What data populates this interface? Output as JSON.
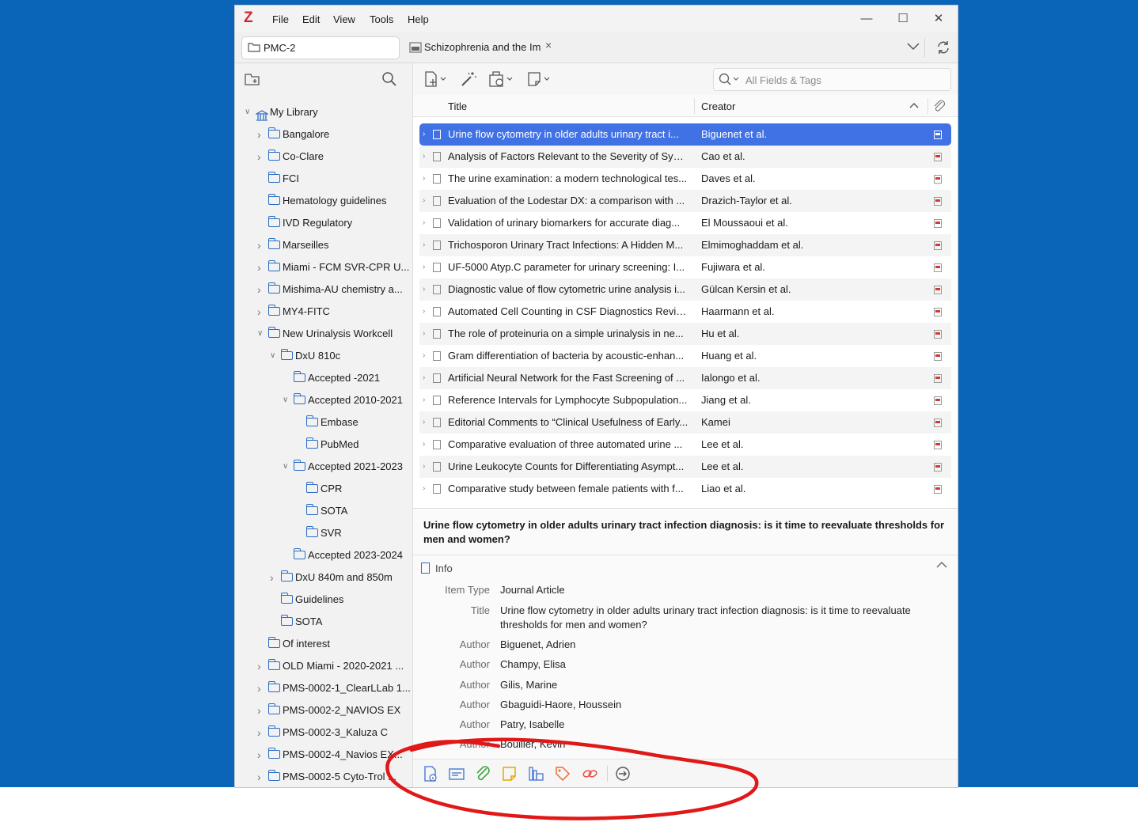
{
  "menubar": {
    "logo": "Z",
    "items": [
      "File",
      "Edit",
      "View",
      "Tools",
      "Help"
    ],
    "minimize_icon": "minimize-icon",
    "maximize_icon": "maximize-icon",
    "close_icon": "close-icon"
  },
  "tabs": {
    "library_tab": "PMC-2",
    "doc_tab": "Schizophrenia and the Im",
    "doc_tab_close": "×"
  },
  "search": {
    "placeholder": "All Fields & Tags"
  },
  "columns": {
    "title": "Title",
    "creator": "Creator",
    "sort_glyph": "^"
  },
  "tree": [
    {
      "label": "My Library",
      "level": 0,
      "twisty": "open",
      "icon": "library"
    },
    {
      "label": "Bangalore",
      "level": 1,
      "twisty": "closed"
    },
    {
      "label": "Co-Clare",
      "level": 1,
      "twisty": "closed"
    },
    {
      "label": "FCI",
      "level": 1,
      "twisty": "none"
    },
    {
      "label": "Hematology guidelines",
      "level": 1,
      "twisty": "none"
    },
    {
      "label": "IVD Regulatory",
      "level": 1,
      "twisty": "none"
    },
    {
      "label": "Marseilles",
      "level": 1,
      "twisty": "closed"
    },
    {
      "label": "Miami - FCM SVR-CPR U...",
      "level": 1,
      "twisty": "closed"
    },
    {
      "label": "Mishima-AU chemistry a...",
      "level": 1,
      "twisty": "closed"
    },
    {
      "label": "MY4-FITC",
      "level": 1,
      "twisty": "closed"
    },
    {
      "label": "New Urinalysis Workcell",
      "level": 1,
      "twisty": "open"
    },
    {
      "label": "DxU 810c",
      "level": 2,
      "twisty": "open"
    },
    {
      "label": "Accepted -2021",
      "level": 3,
      "twisty": "none"
    },
    {
      "label": "Accepted 2010-2021",
      "level": 3,
      "twisty": "open"
    },
    {
      "label": "Embase",
      "level": 4,
      "twisty": "none"
    },
    {
      "label": "PubMed",
      "level": 4,
      "twisty": "none"
    },
    {
      "label": "Accepted 2021-2023",
      "level": 3,
      "twisty": "open"
    },
    {
      "label": "CPR",
      "level": 4,
      "twisty": "none"
    },
    {
      "label": "SOTA",
      "level": 4,
      "twisty": "none"
    },
    {
      "label": "SVR",
      "level": 4,
      "twisty": "none"
    },
    {
      "label": "Accepted 2023-2024",
      "level": 3,
      "twisty": "none"
    },
    {
      "label": "DxU 840m and 850m",
      "level": 2,
      "twisty": "closed"
    },
    {
      "label": "Guidelines",
      "level": 2,
      "twisty": "none"
    },
    {
      "label": "SOTA",
      "level": 2,
      "twisty": "none"
    },
    {
      "label": "Of interest",
      "level": 1,
      "twisty": "none"
    },
    {
      "label": "OLD Miami - 2020-2021 ...",
      "level": 1,
      "twisty": "closed"
    },
    {
      "label": "PMS-0002-1_ClearLLab 1...",
      "level": 1,
      "twisty": "closed"
    },
    {
      "label": "PMS-0002-2_NAVIOS EX",
      "level": 1,
      "twisty": "closed"
    },
    {
      "label": "PMS-0002-3_Kaluza C",
      "level": 1,
      "twisty": "closed"
    },
    {
      "label": "PMS-0002-4_Navios EX...",
      "level": 1,
      "twisty": "closed"
    },
    {
      "label": "PMS-0002-5 Cyto-Trol ...",
      "level": 1,
      "twisty": "closed"
    }
  ],
  "items": [
    {
      "title": "Urine flow cytometry in older adults urinary tract i...",
      "creator": "Biguenet et al.",
      "selected": true
    },
    {
      "title": "Analysis of Factors Relevant to the Severity of Sym...",
      "creator": "Cao et al."
    },
    {
      "title": "The urine examination: a modern technological tes...",
      "creator": "Daves et al."
    },
    {
      "title": "Evaluation of the Lodestar DX: a comparison with ...",
      "creator": "Drazich-Taylor et al."
    },
    {
      "title": "Validation of urinary biomarkers for accurate diag...",
      "creator": "El Moussaoui et al."
    },
    {
      "title": "Trichosporon Urinary Tract Infections: A Hidden M...",
      "creator": "Elmimoghaddam et al."
    },
    {
      "title": "UF-5000 Atyp.C parameter for urinary screening: I...",
      "creator": "Fujiwara et al."
    },
    {
      "title": "Diagnostic value of flow cytometric urine analysis i...",
      "creator": "Gülcan Kersin et al."
    },
    {
      "title": "Automated Cell Counting in CSF Diagnostics Revisi...",
      "creator": "Haarmann et al."
    },
    {
      "title": "The role of proteinuria on a simple urinalysis in ne...",
      "creator": "Hu et al."
    },
    {
      "title": "Gram differentiation of bacteria by acoustic-enhan...",
      "creator": "Huang et al."
    },
    {
      "title": "Artificial Neural Network for the Fast Screening of ...",
      "creator": "Ialongo et al."
    },
    {
      "title": "Reference Intervals for Lymphocyte Subpopulation...",
      "creator": "Jiang et al."
    },
    {
      "title": "Editorial Comments to “Clinical Usefulness of Early...",
      "creator": "Kamei"
    },
    {
      "title": "Comparative evaluation of three automated urine ...",
      "creator": "Lee et al."
    },
    {
      "title": "Urine Leukocyte Counts for Differentiating Asympt...",
      "creator": "Lee et al."
    },
    {
      "title": "Comparative study between female patients with f...",
      "creator": "Liao et al."
    }
  ],
  "detail": {
    "title": "Urine flow cytometry in older adults urinary tract infection diagnosis: is it time to reevaluate thresholds for men and women?",
    "section": "Info",
    "fields": [
      {
        "key": "Item Type",
        "value": "Journal Article"
      },
      {
        "key": "Title",
        "value": "Urine flow cytometry in older adults urinary tract infection diagnosis: is it time to reevaluate thresholds for men and women?"
      },
      {
        "key": "Author",
        "value": "Biguenet, Adrien"
      },
      {
        "key": "Author",
        "value": "Champy, Elisa"
      },
      {
        "key": "Author",
        "value": "Gilis, Marine"
      },
      {
        "key": "Author",
        "value": "Gbaguidi-Haore, Houssein"
      },
      {
        "key": "Author",
        "value": "Patry, Isabelle"
      },
      {
        "key": "Author",
        "value": "Bouiller, Kévin"
      }
    ]
  },
  "sidenav": [
    "info-icon",
    "abstract-icon",
    "attachments-icon",
    "notes-icon",
    "libraries-collections-icon",
    "tags-icon",
    "related-icon",
    "locate-icon"
  ],
  "colors": {
    "desktop": "#0a64b8",
    "selection": "#4072e5",
    "annotation": "#e01818",
    "folder": "#2b6cc4"
  }
}
